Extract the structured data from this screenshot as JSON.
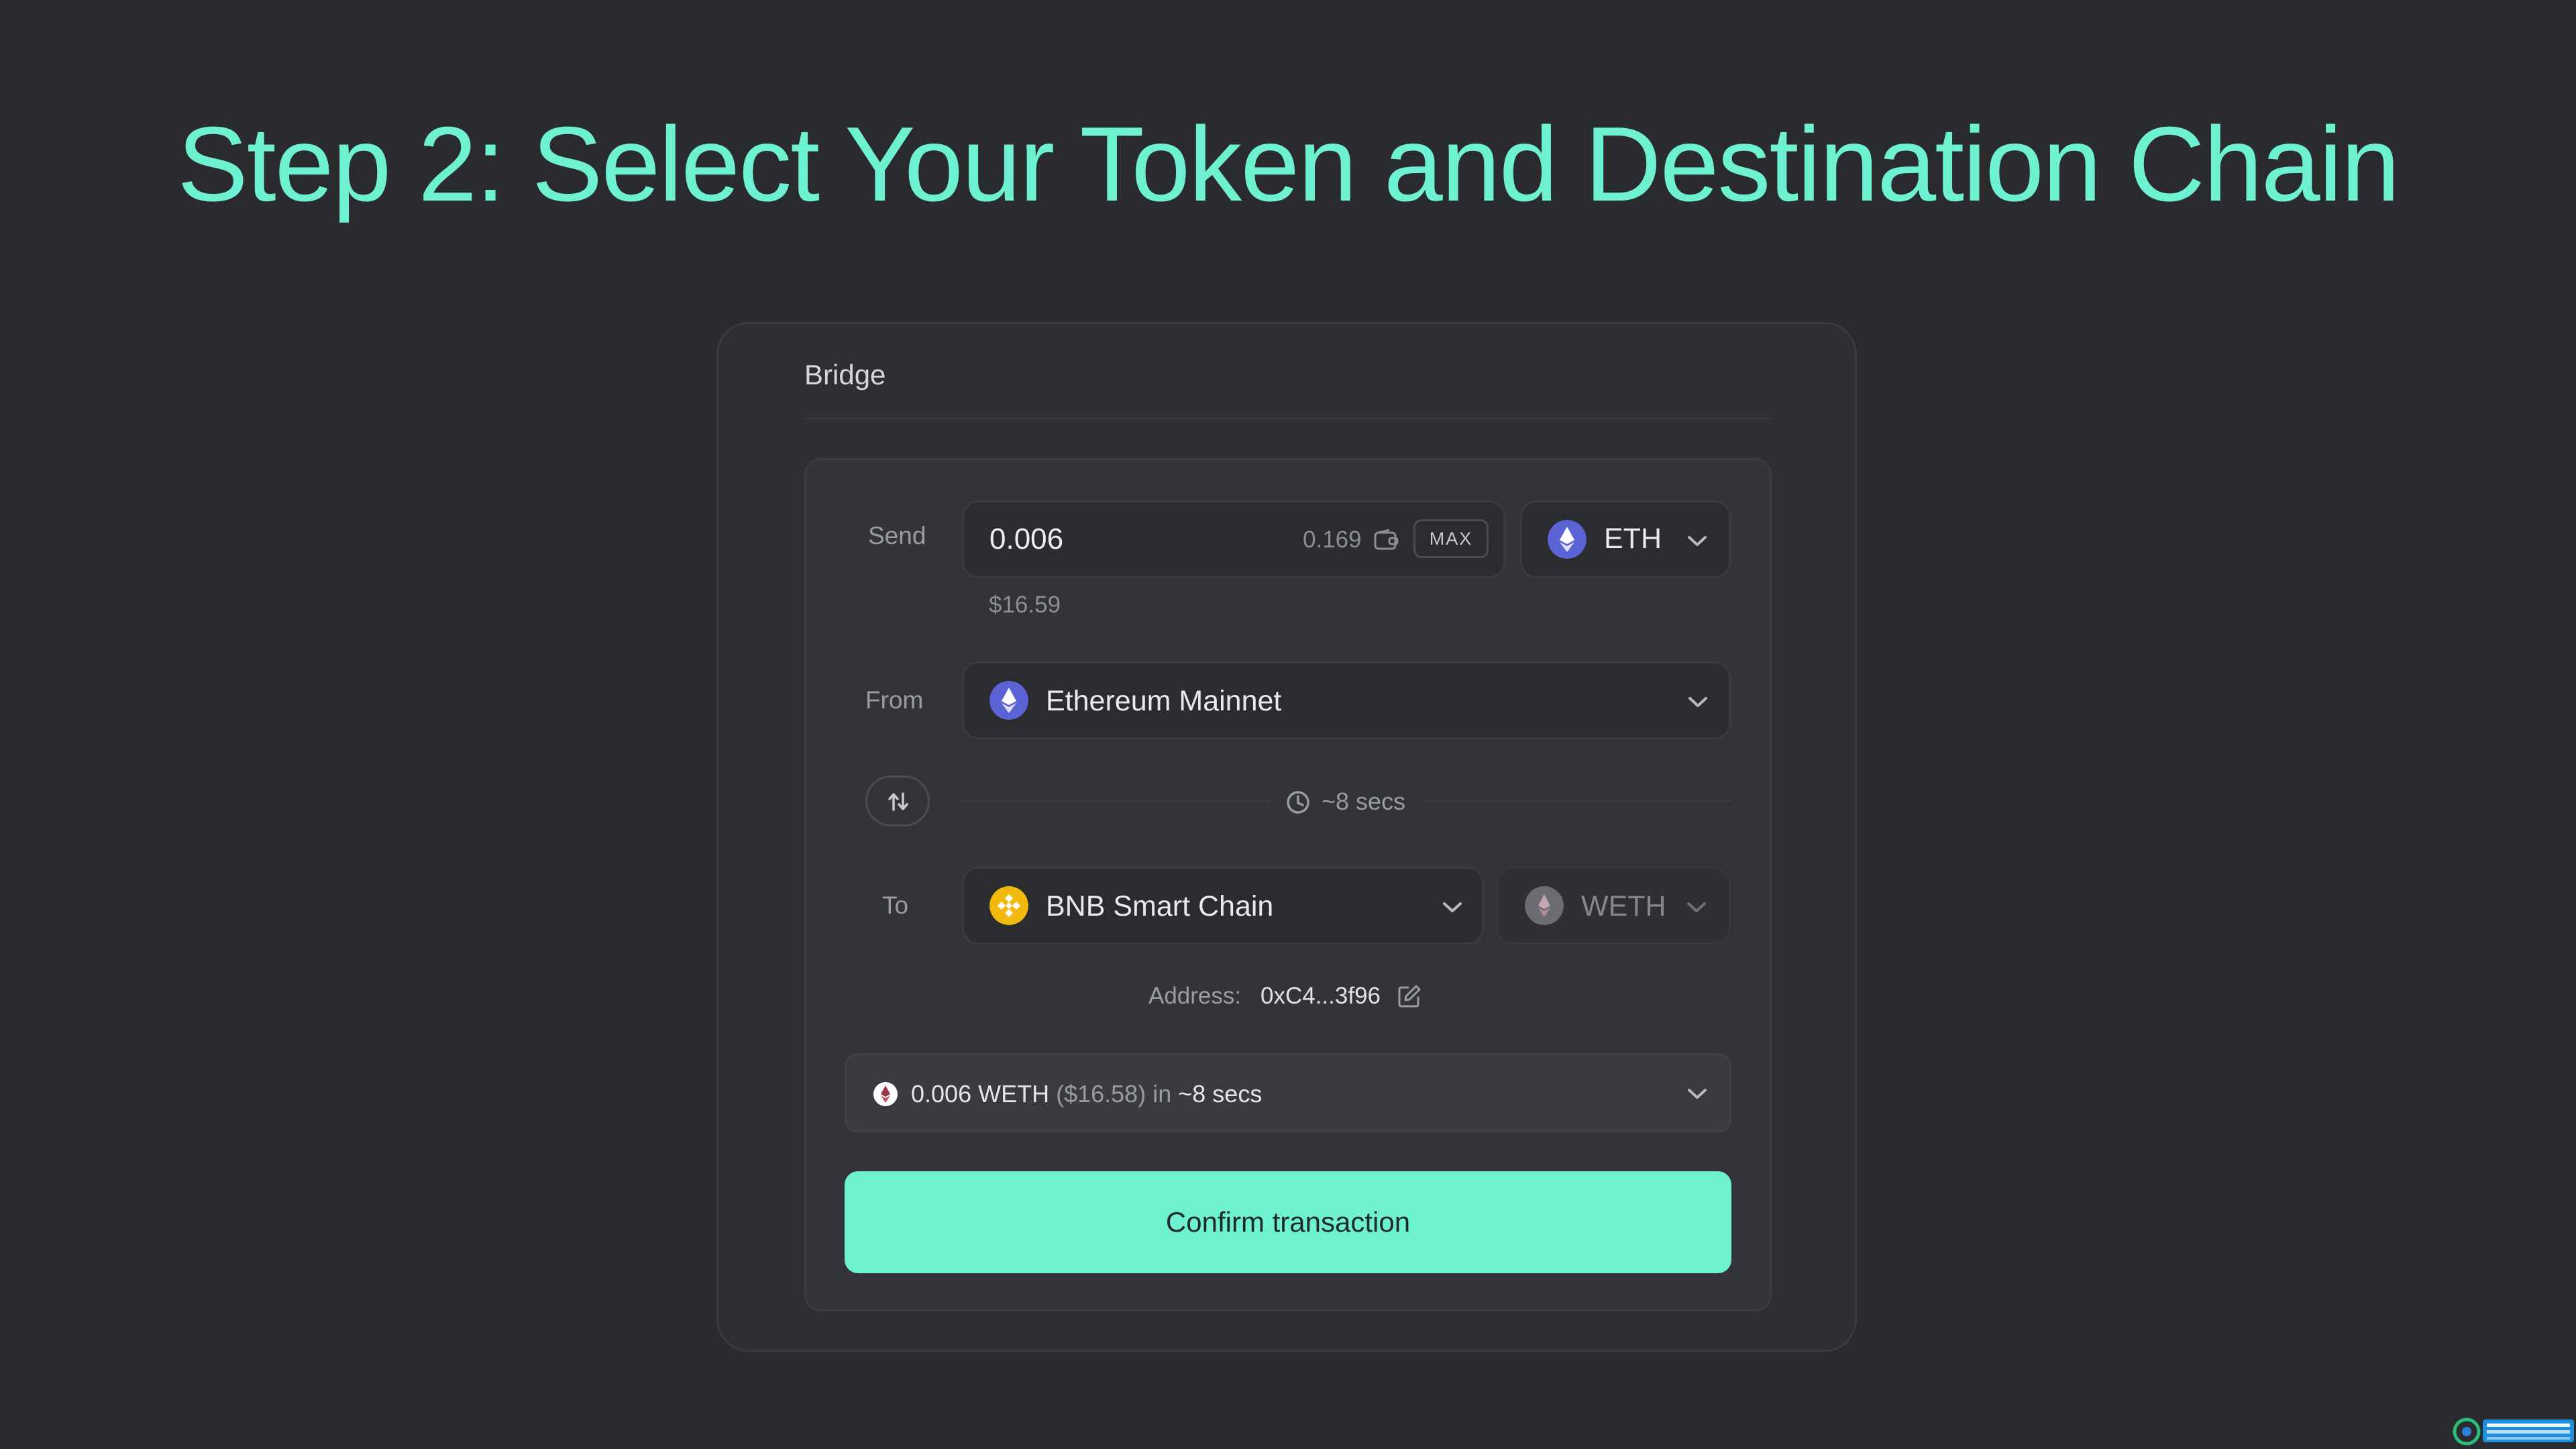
{
  "headline": "Step 2: Select Your Token and Destination Chain",
  "bridge": {
    "title": "Bridge",
    "send": {
      "label": "Send",
      "amount": "0.006",
      "balance": "0.169",
      "max_label": "MAX",
      "usd_value": "$16.59",
      "token": "ETH",
      "token_icon": "ethereum-icon"
    },
    "from": {
      "label": "From",
      "chain": "Ethereum Mainnet",
      "chain_icon": "ethereum-icon"
    },
    "eta": "~8 secs",
    "to": {
      "label": "To",
      "chain": "BNB Smart Chain",
      "chain_icon": "bnb-icon",
      "token": "WETH",
      "token_icon": "weth-icon"
    },
    "address": {
      "label": "Address:",
      "value": "0xC4...3f96"
    },
    "summary": {
      "amount": "0.006 WETH",
      "usd": "($16.58)",
      "connector": "in",
      "time": "~8 secs"
    },
    "confirm_label": "Confirm transaction"
  },
  "colors": {
    "accent": "#6df1d0",
    "background": "#2a2b2f",
    "card": "#2e2f33",
    "eth": "#5b63d6",
    "bnb": "#f0b90b"
  }
}
